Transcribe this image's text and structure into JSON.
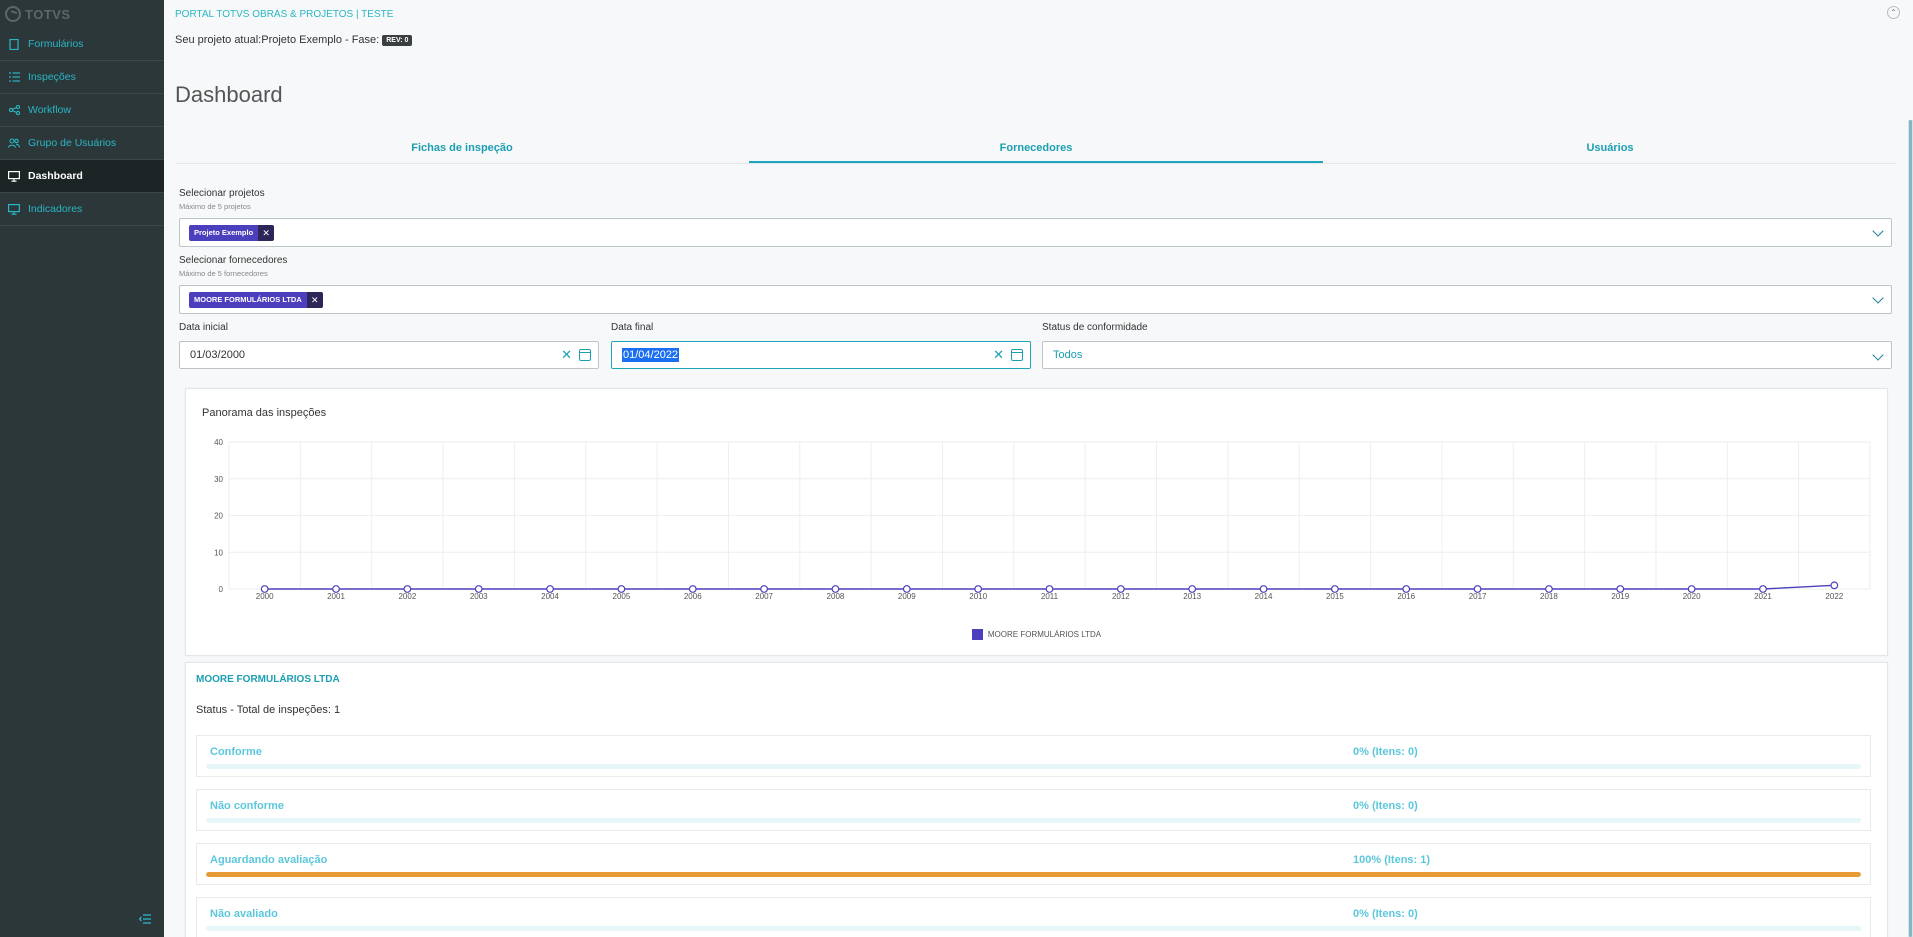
{
  "sidebar": {
    "logo": "TOTVS",
    "items": [
      {
        "label": "Formulários",
        "icon": "file-icon"
      },
      {
        "label": "Inspeções",
        "icon": "list-icon"
      },
      {
        "label": "Workflow",
        "icon": "share-icon"
      },
      {
        "label": "Grupo de Usuários",
        "icon": "users-icon"
      },
      {
        "label": "Dashboard",
        "icon": "monitor-icon",
        "active": true
      },
      {
        "label": "Indicadores",
        "icon": "monitor-icon"
      }
    ],
    "collapse_icon": "collapse-menu-icon"
  },
  "header": {
    "portal": "PORTAL TOTVS OBRAS & PROJETOS | TESTE",
    "project_line": "Seu projeto atual:Projeto Exemplo - Fase:",
    "rev_badge": "REV: 0",
    "title": "Dashboard"
  },
  "tabs": [
    {
      "label": "Fichas de inspeção"
    },
    {
      "label": "Fornecedores",
      "active": true
    },
    {
      "label": "Usuários"
    }
  ],
  "filters": {
    "projects": {
      "label": "Selecionar projetos",
      "hint": "Máximo de 5 projetos",
      "chip": "Projeto Exemplo"
    },
    "suppliers": {
      "label": "Selecionar fornecedores",
      "hint": "Máximo de 5 fornecedores",
      "chip": "MOORE FORMULÁRIOS LTDA"
    },
    "start_date": {
      "label": "Data inicial",
      "value": "01/03/2000"
    },
    "end_date": {
      "label": "Data final",
      "value": "01/04/2022"
    },
    "status": {
      "label": "Status de conformidade",
      "value": "Todos"
    }
  },
  "chart_data": {
    "type": "line",
    "title": "Panorama das inspeções",
    "xlabel": "",
    "ylabel": "",
    "categories": [
      "2000",
      "2001",
      "2002",
      "2003",
      "2004",
      "2005",
      "2006",
      "2007",
      "2008",
      "2009",
      "2010",
      "2011",
      "2012",
      "2013",
      "2014",
      "2015",
      "2016",
      "2017",
      "2018",
      "2019",
      "2020",
      "2021",
      "2022"
    ],
    "yticks": [
      "0",
      "10",
      "20",
      "30",
      "40"
    ],
    "ylim": [
      0,
      40
    ],
    "grid": true,
    "legend_position": "bottom",
    "series": [
      {
        "name": "MOORE FORMULÁRIOS LTDA",
        "color": "#4c3fbe",
        "values": [
          0,
          0,
          0,
          0,
          0,
          0,
          0,
          0,
          0,
          0,
          0,
          0,
          0,
          0,
          0,
          0,
          0,
          0,
          0,
          0,
          0,
          0,
          1
        ]
      }
    ]
  },
  "status_panel": {
    "supplier": "MOORE FORMULÁRIOS LTDA",
    "total": "Status - Total de inspeções: 1",
    "items": [
      {
        "label": "Conforme",
        "percent_text": "0% (Itens: 0)",
        "fraction": 0
      },
      {
        "label": "Não conforme",
        "percent_text": "0% (Itens: 0)",
        "fraction": 0
      },
      {
        "label": "Aguardando avaliação",
        "percent_text": "100% (Itens: 1)",
        "fraction": 1
      },
      {
        "label": "Não avaliado",
        "percent_text": "0% (Itens: 0)",
        "fraction": 0
      }
    ]
  },
  "colors": {
    "accent": "#1ea6bf",
    "sidebar": "#2c3739",
    "chip": "#4c3fbe",
    "progress": "#e89a35"
  }
}
